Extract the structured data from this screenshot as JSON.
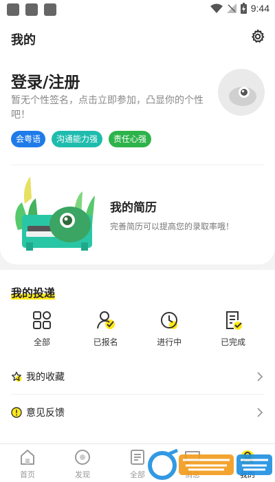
{
  "status_bar": {
    "time": "9:44"
  },
  "header": {
    "title": "我的"
  },
  "profile": {
    "login_label": "登录/注册",
    "signature": "暂无个性签名，点击立即参加，凸显你的个性吧！",
    "tags": [
      {
        "label": "会粤语",
        "color": "#1e7be8"
      },
      {
        "label": "沟通能力强",
        "color": "#1fbcae"
      },
      {
        "label": "责任心强",
        "color": "#2db34a"
      }
    ]
  },
  "resume": {
    "title": "我的简历",
    "subtitle": "完善简历可以提高您的录取率哦！"
  },
  "deliveries": {
    "title": "我的投递",
    "items": [
      {
        "label": "全部",
        "icon": "grid-icon"
      },
      {
        "label": "已报名",
        "icon": "user-check-icon"
      },
      {
        "label": "进行中",
        "icon": "clock-icon"
      },
      {
        "label": "已完成",
        "icon": "document-check-icon"
      }
    ]
  },
  "menu": [
    {
      "label": "我的收藏",
      "icon": "star-icon"
    },
    {
      "label": "意见反馈",
      "icon": "feedback-icon"
    }
  ],
  "bottom_nav": [
    {
      "label": "首页",
      "icon": "home-icon",
      "active": false
    },
    {
      "label": "发现",
      "icon": "discover-icon",
      "active": false
    },
    {
      "label": "全部",
      "icon": "list-icon",
      "active": false
    },
    {
      "label": "消息",
      "icon": "message-icon",
      "active": false
    },
    {
      "label": "我的",
      "icon": "profile-icon",
      "active": true
    }
  ],
  "colors": {
    "highlight": "#ffe81a",
    "accent": "#1fbcae",
    "chevron": "#999999"
  }
}
